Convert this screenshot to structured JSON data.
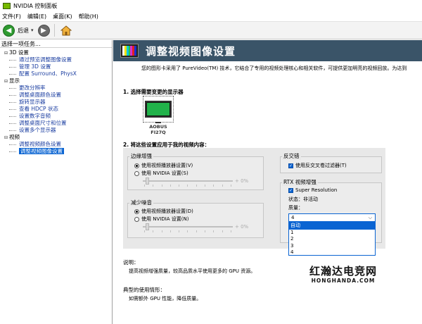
{
  "window": {
    "title": "NVIDIA 控制面板"
  },
  "menu": [
    "文件(F)",
    "编辑(E)",
    "桌面(K)",
    "帮助(H)"
  ],
  "toolbar": {
    "back_label": "后退",
    "dropdown_glyph": "▾"
  },
  "sidebar": {
    "header": "选择一项任务...",
    "tree": [
      {
        "kind": "cat",
        "label": "3D 设置"
      },
      {
        "kind": "leaf",
        "label": "通过预览调整图像设置"
      },
      {
        "kind": "leaf",
        "label": "管理 3D 设置"
      },
      {
        "kind": "leaf",
        "label": "配置 Surround、PhysX"
      },
      {
        "kind": "cat",
        "label": "显示"
      },
      {
        "kind": "leaf",
        "label": "更改分辨率"
      },
      {
        "kind": "leaf",
        "label": "调整桌面颜色设置"
      },
      {
        "kind": "leaf",
        "label": "旋转显示器"
      },
      {
        "kind": "leaf",
        "label": "查看 HDCP 状态"
      },
      {
        "kind": "leaf",
        "label": "设置数字音频"
      },
      {
        "kind": "leaf",
        "label": "调整桌面尺寸和位置"
      },
      {
        "kind": "leaf",
        "label": "设置多个显示器"
      },
      {
        "kind": "cat",
        "label": "视频"
      },
      {
        "kind": "leaf",
        "label": "调整视频颜色设置"
      },
      {
        "kind": "leaf",
        "label": "调整视频图像设置",
        "selected": true
      }
    ]
  },
  "page": {
    "title": "调整视频图像设置",
    "description": "您的图形卡采用了 PureVideo(TM) 技术，它结合了专用的视频处理核心和相关软件，可提供更加明亮的视频回放。为达到",
    "step1": "1.  选择需要变更的显示器",
    "display_name": "AOBUS FI27Q",
    "step2": "2.  将这些设置应用于我的视频内容：",
    "edge": {
      "label": "边缘增强",
      "opt_player": "使用视频播放器设置(V)",
      "opt_nvidia": "使用 NVIDIA 设置(S)",
      "value": "+ 0%"
    },
    "noise": {
      "label": "减少噪音",
      "opt_player": "使用视频播放器设置(D)",
      "opt_nvidia": "使用 NVIDIA 设置(N)",
      "value": "+ 0%"
    },
    "deinterlace": {
      "label": "反交错",
      "opt": "使用反交叉卷过滤器(T)"
    },
    "rtx": {
      "label": "RTX 视频增强",
      "super_resolution": "Super Resolution",
      "status": "状态：非活动",
      "quality_label": "质量：",
      "quality_value": "4",
      "quality_options": [
        "自动",
        "1",
        "2",
        "3",
        "4"
      ],
      "highlighted_option": "自动"
    },
    "info": {
      "desc_title": "说明：",
      "desc_body": "提高视频增强质量，较高品质水平使用更多的 GPU 资源。",
      "usage_title": "典型的使用情形：",
      "usage_body": "如需额外 GPU 性能，降低质量。"
    }
  },
  "watermark": {
    "line1": "红瀚达电竞网",
    "line2": "HONGHANDA.COM"
  },
  "colors": {
    "banner": "#3a5468",
    "selection": "#0a64d2",
    "back_button": "#2e9a30",
    "panel": "#e8e8e8"
  }
}
